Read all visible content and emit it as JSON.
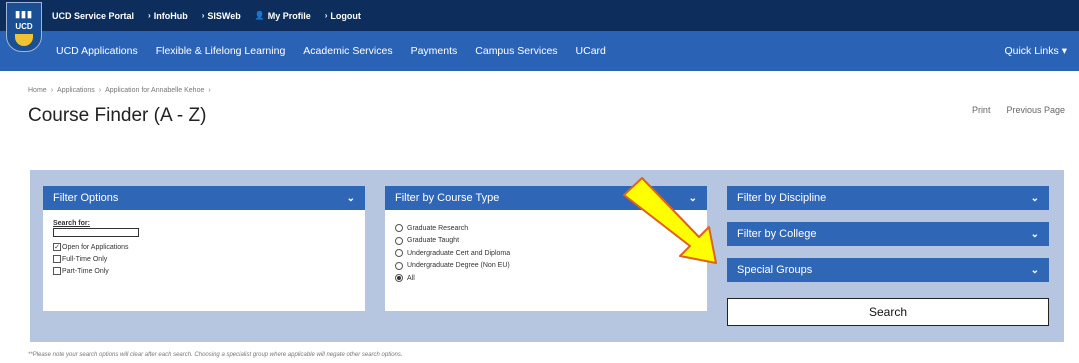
{
  "topbar": {
    "crest_top": "▮▮▮",
    "crest_text": "UCD",
    "links": [
      "UCD Service Portal",
      "InfoHub",
      "SISWeb",
      "My Profile",
      "Logout"
    ]
  },
  "nav": {
    "items": [
      "UCD Applications",
      "Flexible & Lifelong Learning",
      "Academic Services",
      "Payments",
      "Campus Services",
      "UCard"
    ],
    "quick_links": "Quick Links"
  },
  "breadcrumb": [
    "Home",
    "Applications",
    "Application for Annabelle Kehoe"
  ],
  "page": {
    "title": "Course Finder (A - Z)",
    "print": "Print",
    "previous_page": "Previous Page"
  },
  "filter_options": {
    "header": "Filter Options",
    "search_label": "Search for:",
    "search_value": "",
    "checks": [
      {
        "label": "Open for Applications",
        "checked": "✓"
      },
      {
        "label": "Full-Time Only",
        "checked": ""
      },
      {
        "label": "Part-Time Only",
        "checked": ""
      }
    ]
  },
  "course_type": {
    "header": "Filter by Course Type",
    "options": [
      "Graduate Research",
      "Graduate Taught",
      "Undergraduate Cert and Diploma",
      "Undergraduate Degree (Non EU)",
      "All"
    ],
    "selected": "All"
  },
  "right_filters": [
    "Filter by Discipline",
    "Filter by College",
    "Special Groups"
  ],
  "search_button": "Search",
  "footnote": "**Please note your search options will clear after each search. Choosing a specialist group where applicable will negate other search options.",
  "colors": {
    "topbar": "#0d2e5c",
    "nav": "#2a63b5",
    "panel_header": "#2f66b6",
    "panel_bg": "#b6c6e1",
    "arrow_fill": "#ffff00",
    "arrow_stroke": "#e06020"
  }
}
